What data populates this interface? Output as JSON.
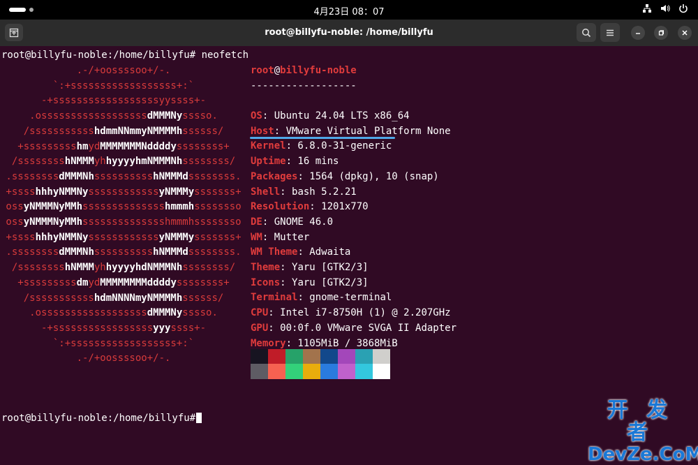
{
  "topbar": {
    "clock": "4月23日  08：07"
  },
  "window": {
    "title": "root@billyfu-noble: /home/billyfu"
  },
  "prompt": {
    "text": "root@billyfu-noble:/home/billyfu# ",
    "command": "neofetch"
  },
  "logo_lines": [
    [
      {
        "t": "             .-/+oossssoo+/-.",
        "b": false
      }
    ],
    [
      {
        "t": "         `:+ssssssssssssssssss+:`",
        "b": false
      }
    ],
    [
      {
        "t": "       -+ssssssssssssssssssyyssss+-",
        "b": false
      }
    ],
    [
      {
        "t": "     .ossssssssssssssssss",
        "b": false
      },
      {
        "t": "dMMMNy",
        "b": true
      },
      {
        "t": "sssso.",
        "b": false
      }
    ],
    [
      {
        "t": "    /sssssssssss",
        "b": false
      },
      {
        "t": "hdmmNNmmyNMMMMh",
        "b": true
      },
      {
        "t": "ssssss/",
        "b": false
      }
    ],
    [
      {
        "t": "   +sssssssss",
        "b": false
      },
      {
        "t": "hm",
        "b": true
      },
      {
        "t": "yd",
        "b": false
      },
      {
        "t": "MMMMMMMNddddy",
        "b": true
      },
      {
        "t": "ssssssss+",
        "b": false
      }
    ],
    [
      {
        "t": "  /ssssssss",
        "b": false
      },
      {
        "t": "hNMMM",
        "b": true
      },
      {
        "t": "yh",
        "b": false
      },
      {
        "t": "hyyyyhmNMMMNh",
        "b": true
      },
      {
        "t": "ssssssss/",
        "b": false
      }
    ],
    [
      {
        "t": " .ssssssss",
        "b": false
      },
      {
        "t": "dMMMNh",
        "b": true
      },
      {
        "t": "ssssssssss",
        "b": false
      },
      {
        "t": "hNMMMd",
        "b": true
      },
      {
        "t": "ssssssss.",
        "b": false
      }
    ],
    [
      {
        "t": " +ssss",
        "b": false
      },
      {
        "t": "hhhyNMMNy",
        "b": true
      },
      {
        "t": "ssssssssssss",
        "b": false
      },
      {
        "t": "yNMMMy",
        "b": true
      },
      {
        "t": "sssssss+",
        "b": false
      }
    ],
    [
      {
        "t": " oss",
        "b": false
      },
      {
        "t": "yNMMMNyMMh",
        "b": true
      },
      {
        "t": "ssssssssssssss",
        "b": false
      },
      {
        "t": "hmmmh",
        "b": true
      },
      {
        "t": "ssssssso",
        "b": false
      }
    ],
    [
      {
        "t": " oss",
        "b": false
      },
      {
        "t": "yNMMMNyMMh",
        "b": true
      },
      {
        "t": "sssssssssssssshmmmhssssssso",
        "b": false
      }
    ],
    [
      {
        "t": " +ssss",
        "b": false
      },
      {
        "t": "hhhyNMMNy",
        "b": true
      },
      {
        "t": "ssssssssssss",
        "b": false
      },
      {
        "t": "yNMMMy",
        "b": true
      },
      {
        "t": "sssssss+",
        "b": false
      }
    ],
    [
      {
        "t": " .ssssssss",
        "b": false
      },
      {
        "t": "dMMMNh",
        "b": true
      },
      {
        "t": "ssssssssss",
        "b": false
      },
      {
        "t": "hNMMMd",
        "b": true
      },
      {
        "t": "ssssssss.",
        "b": false
      }
    ],
    [
      {
        "t": "  /ssssssss",
        "b": false
      },
      {
        "t": "hNMMM",
        "b": true
      },
      {
        "t": "yh",
        "b": false
      },
      {
        "t": "hyyyyhdNMMMNh",
        "b": true
      },
      {
        "t": "ssssssss/",
        "b": false
      }
    ],
    [
      {
        "t": "   +sssssssss",
        "b": false
      },
      {
        "t": "dm",
        "b": true
      },
      {
        "t": "yd",
        "b": false
      },
      {
        "t": "MMMMMMMMddddy",
        "b": true
      },
      {
        "t": "ssssssss+",
        "b": false
      }
    ],
    [
      {
        "t": "    /sssssssssss",
        "b": false
      },
      {
        "t": "hdmNNNNmyNMMMMh",
        "b": true
      },
      {
        "t": "ssssss/",
        "b": false
      }
    ],
    [
      {
        "t": "     .ossssssssssssssssss",
        "b": false
      },
      {
        "t": "dMMMNy",
        "b": true
      },
      {
        "t": "sssso.",
        "b": false
      }
    ],
    [
      {
        "t": "       -+sssssssssssssssss",
        "b": false
      },
      {
        "t": "yyy",
        "b": true
      },
      {
        "t": "ssss+-",
        "b": false
      }
    ],
    [
      {
        "t": "         `:+ssssssssssssssssss+:`",
        "b": false
      }
    ],
    [
      {
        "t": "             .-/+oossssoo+/-.",
        "b": false
      }
    ]
  ],
  "info": {
    "user": "root",
    "at": "@",
    "host": "billyfu-noble",
    "separator": "------------------",
    "rows": [
      {
        "key": "OS",
        "value": ": Ubuntu 24.04 LTS x86_64"
      },
      {
        "key": "Host",
        "value": ": VMware Virtual Platform None"
      },
      {
        "key": "Kernel",
        "value": ": 6.8.0-31-generic"
      },
      {
        "key": "Uptime",
        "value": ": 16 mins"
      },
      {
        "key": "Packages",
        "value": ": 1564 (dpkg), 10 (snap)"
      },
      {
        "key": "Shell",
        "value": ": bash 5.2.21"
      },
      {
        "key": "Resolution",
        "value": ": 1201x770"
      },
      {
        "key": "DE",
        "value": ": GNOME 46.0"
      },
      {
        "key": "WM",
        "value": ": Mutter"
      },
      {
        "key": "WM Theme",
        "value": ": Adwaita"
      },
      {
        "key": "Theme",
        "value": ": Yaru [GTK2/3]"
      },
      {
        "key": "Icons",
        "value": ": Yaru [GTK2/3]"
      },
      {
        "key": "Terminal",
        "value": ": gnome-terminal"
      },
      {
        "key": "CPU",
        "value": ": Intel i7-8750H (1) @ 2.207GHz"
      },
      {
        "key": "GPU",
        "value": ": 00:0f.0 VMware SVGA II Adapter"
      },
      {
        "key": "Memory",
        "value": ": 1105MiB / 3868MiB"
      }
    ]
  },
  "palette": {
    "row1": [
      "#171421",
      "#c01c28",
      "#26a269",
      "#a2734c",
      "#12488b",
      "#a347ba",
      "#2aa1b3",
      "#d0cfcc"
    ],
    "row2": [
      "#5e5c64",
      "#f66151",
      "#33d17a",
      "#e9ad0c",
      "#2a7bde",
      "#c061cb",
      "#33c7de",
      "#ffffff"
    ]
  },
  "prompt2": {
    "text": "root@billyfu-noble:/home/billyfu#"
  },
  "watermark": {
    "cn": "开 发 者",
    "en": "DevZe.CoM"
  }
}
